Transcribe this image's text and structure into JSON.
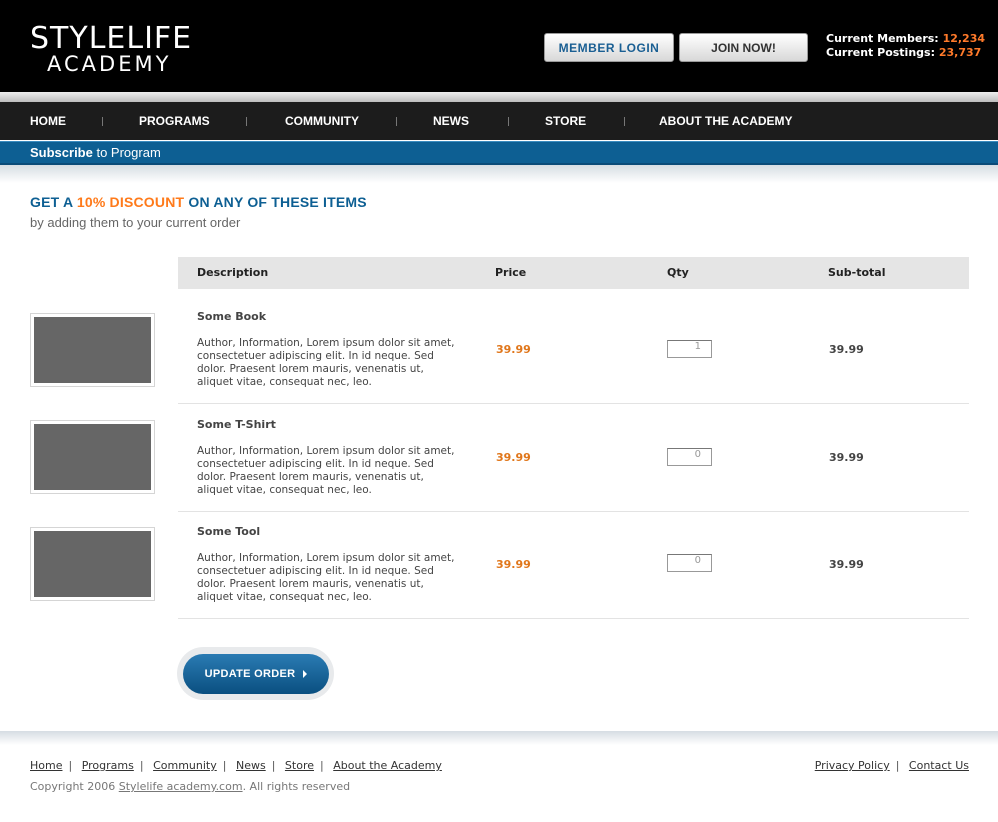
{
  "header": {
    "logo_line1": "STYLELIFE",
    "logo_line2": "ACADEMY",
    "login_label": "MEMBER  LOGIN",
    "join_label": "JOIN NOW!",
    "members_label": "Current Members:",
    "members_value": "12,234",
    "postings_label": "Current Postings:",
    "postings_value": "23,737"
  },
  "nav": {
    "items": [
      {
        "label": "HOME"
      },
      {
        "label": "PROGRAMS"
      },
      {
        "label": "COMMUNITY"
      },
      {
        "label": "NEWS"
      },
      {
        "label": "STORE"
      },
      {
        "label": "ABOUT THE ACADEMY"
      }
    ]
  },
  "subscribe": {
    "bold": "Subscribe",
    "rest": " to Program"
  },
  "promo": {
    "part1": "GET A ",
    "discount": "10% DISCOUNT",
    "part2": " ON ANY OF THESE ITEMS",
    "subtitle": "by adding them to your current order"
  },
  "table": {
    "headers": {
      "description": "Description",
      "price": "Price",
      "qty": "Qty",
      "subtotal": "Sub-total"
    },
    "rows": [
      {
        "name": "Some Book",
        "desc": "Author, Information, Lorem ipsum dolor sit amet, consectetuer adipiscing elit. In id neque. Sed dolor. Praesent lorem mauris, venenatis ut, aliquet vitae, consequat nec, leo.",
        "price": "39.99",
        "qty": "1",
        "subtotal": "39.99"
      },
      {
        "name": "Some T-Shirt",
        "desc": "Author, Information, Lorem ipsum dolor sit amet, consectetuer adipiscing elit. In id neque. Sed dolor. Praesent lorem mauris, venenatis ut, aliquet vitae, consequat nec, leo.",
        "price": "39.99",
        "qty": "0",
        "subtotal": "39.99"
      },
      {
        "name": "Some Tool",
        "desc": "Author, Information, Lorem ipsum dolor sit amet, consectetuer adipiscing elit. In id neque. Sed dolor. Praesent lorem mauris, venenatis ut, aliquet vitae, consequat nec, leo.",
        "price": "39.99",
        "qty": "0",
        "subtotal": "39.99"
      }
    ]
  },
  "update_button": "UPDATE ORDER",
  "footer": {
    "links": [
      "Home",
      "Programs",
      "Community",
      "News",
      "Store",
      "About the Academy"
    ],
    "right_links": [
      "Privacy Policy",
      "Contact Us"
    ],
    "copyright_prefix": "Copyright 2006 ",
    "copyright_link": "Stylelife academy.com",
    "copyright_suffix": ".  All rights reserved"
  },
  "colors": {
    "brand_blue": "#0d5f93",
    "accent_orange": "#ff7a1a"
  }
}
